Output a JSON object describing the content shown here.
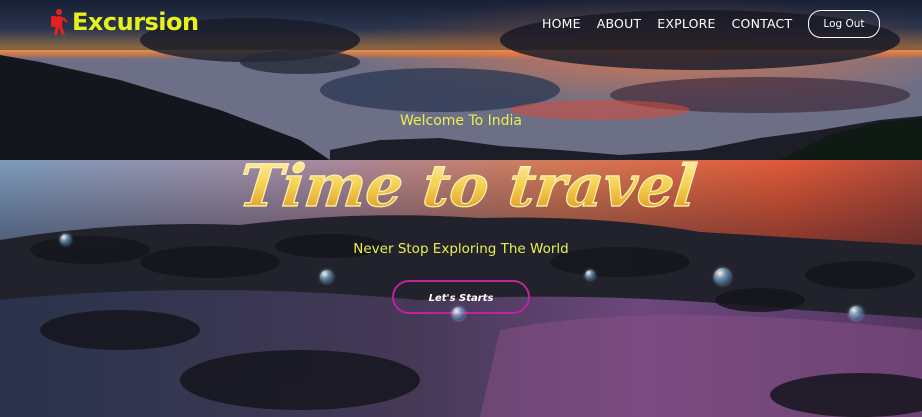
{
  "brand": {
    "name": "Excursion",
    "icon": "hiker-icon",
    "color": "#e6f21c"
  },
  "nav": {
    "items": [
      {
        "label": "HOME"
      },
      {
        "label": "ABOUT"
      },
      {
        "label": "EXPLORE"
      },
      {
        "label": "CONTACT"
      }
    ],
    "logout_label": "Log Out"
  },
  "hero": {
    "welcome": "Welcome To India",
    "headline": "Time to travel",
    "tagline": "Never Stop Exploring The World",
    "cta_label": "Let's Starts",
    "accent_color": "#e8f050",
    "cta_border_color": "#c0239a"
  }
}
